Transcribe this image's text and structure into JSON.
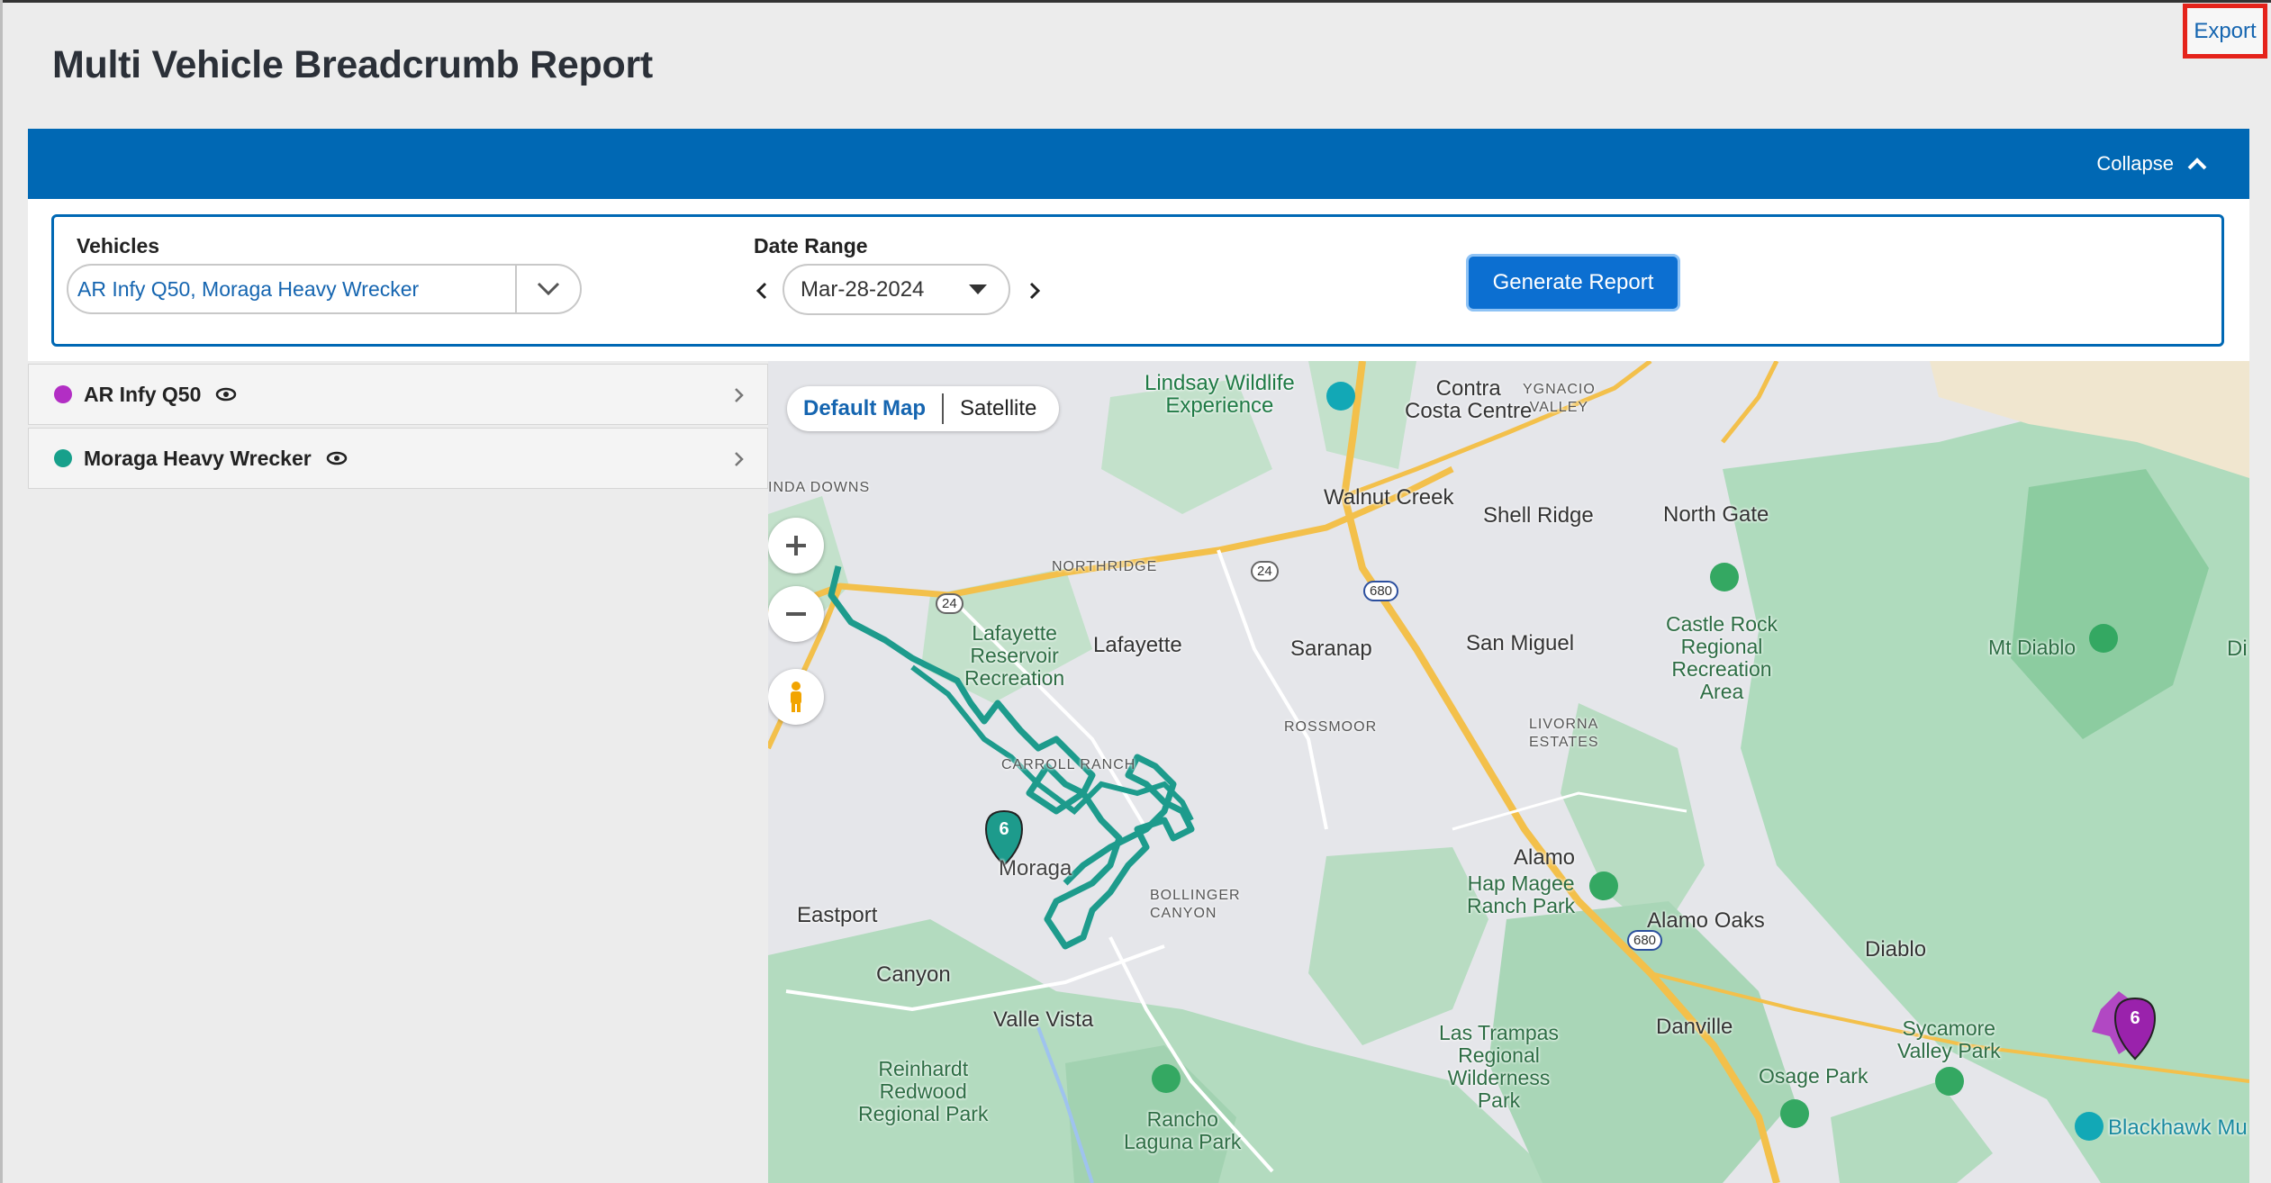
{
  "page": {
    "title": "Multi Vehicle Breadcrumb Report",
    "export_label": "Export"
  },
  "panel": {
    "collapse_label": "Collapse"
  },
  "filters": {
    "vehicles_label": "Vehicles",
    "vehicles_value": "AR Infy Q50, Moraga Heavy Wrecker",
    "date_range_label": "Date Range",
    "date_value": "Mar-28-2024",
    "generate_label": "Generate Report"
  },
  "vehicles": [
    {
      "name": "AR Infy Q50",
      "color": "#b22ec4"
    },
    {
      "name": "Moraga Heavy Wrecker",
      "color": "#17a08b"
    }
  ],
  "map": {
    "toggle": {
      "default_label": "Default Map",
      "satellite_label": "Satellite"
    },
    "marker_count": "6",
    "places": {
      "walnut_creek": "Walnut Creek",
      "shell_ridge": "Shell Ridge",
      "north_gate": "North Gate",
      "contra_costa": "Contra\nCosta Centre",
      "lindsay": "Lindsay Wildlife\nExperience",
      "ygnacio": "YGNACIO\nVALLEY",
      "northridge": "NORTHRIDGE",
      "lafayette": "Lafayette",
      "lafayette_res": "Lafayette\nReservoir\nRecreation",
      "saranap": "Saranap",
      "san_miguel": "San Miguel",
      "castle_rock": "Castle Rock\nRegional\nRecreation\nArea",
      "mt_diablo": "Mt Diablo",
      "rossmoor": "ROSSMOOR",
      "livorna": "LIVORNA\nESTATES",
      "carroll_ranch": "CARROLL RANCH",
      "alamo": "Alamo",
      "hap_magee": "Hap Magee\nRanch Park",
      "alamo_oaks": "Alamo Oaks",
      "diablo": "Diablo",
      "eastport": "Eastport",
      "canyon": "Canyon",
      "valle_vista": "Valle Vista",
      "danville": "Danville",
      "las_trampas": "Las Trampas\nRegional\nWilderness\nPark",
      "sycamore": "Sycamore\nValley Park",
      "osage": "Osage Park",
      "reinhardt": "Reinhardt\nRedwood\nRegional Park",
      "rancho_laguna": "Rancho\nLaguna Park",
      "blackhawk": "Blackhawk Mu",
      "bollinger": "BOLLINGER\nCANYON",
      "inda_downs": "INDA DOWNS",
      "moraga": "Moraga",
      "di": "Di"
    },
    "shields": {
      "r24": "24",
      "i680": "680"
    }
  }
}
